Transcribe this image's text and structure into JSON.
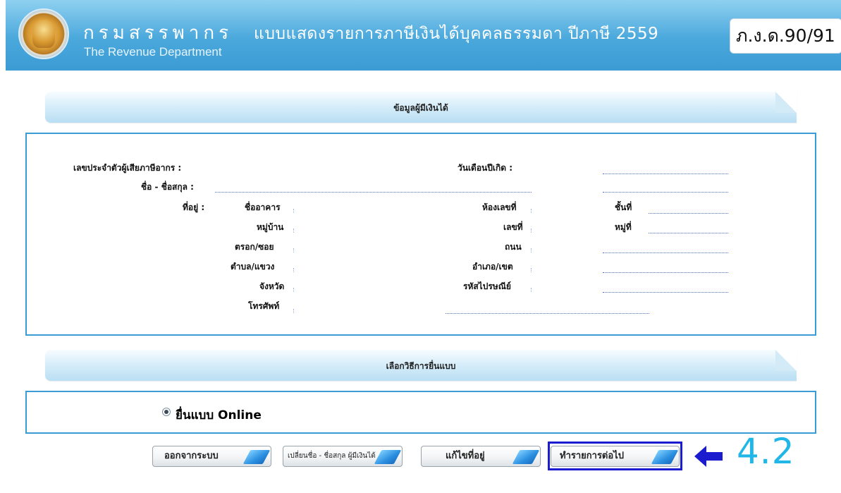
{
  "header": {
    "brand_th": "กรมสรรพากร",
    "brand_en": "The Revenue Department",
    "form_title": "แบบแสดงรายการภาษีเงินได้บุคคลธรรมดา ปีภาษี 2559",
    "form_code": "ภ.ง.ด.90/91"
  },
  "income_earner_section": {
    "title": "ข้อมูลผู้มีเงินได้",
    "tax_id_label": "เลขประจำตัวผู้เสียภาษีอากร :",
    "birth_date_label": "วันเดือนปีเกิด :",
    "name_label": "ชื่อ - ชื่อสกุล :",
    "address_label": "ที่อยู่ :",
    "building_label": "ชื่ออาคาร",
    "room_label": "ห้องเลขที่",
    "floor_label": "ชั้นที่",
    "village_label": "หมู่บ้าน",
    "house_no_label": "เลขที่",
    "moo_label": "หมู่ที่",
    "soi_label": "ตรอก/ซอย",
    "road_label": "ถนน",
    "subdistrict_label": "ตำบล/แขวง",
    "district_label": "อำเภอ/เขต",
    "province_label": "จังหวัด",
    "postcode_label": "รหัสไปรษณีย์",
    "phone_label": "โทรศัพท์"
  },
  "filing_method_section": {
    "title": "เลือกวิธีการยื่นแบบ",
    "option_label": "ยื่นแบบ Online"
  },
  "buttons": {
    "logout": "ออกจากระบบ",
    "change_name": "เปลี่ยนชื่อ - ชื่อสกุล ผู้มีเงินได้",
    "edit_address": "แก้ไขที่อยู่",
    "continue": "ทำรายการต่อไป"
  },
  "annotation": {
    "step": "4.2",
    "arrow_color": "#1c1ccf",
    "step_color": "#21b6e8"
  }
}
